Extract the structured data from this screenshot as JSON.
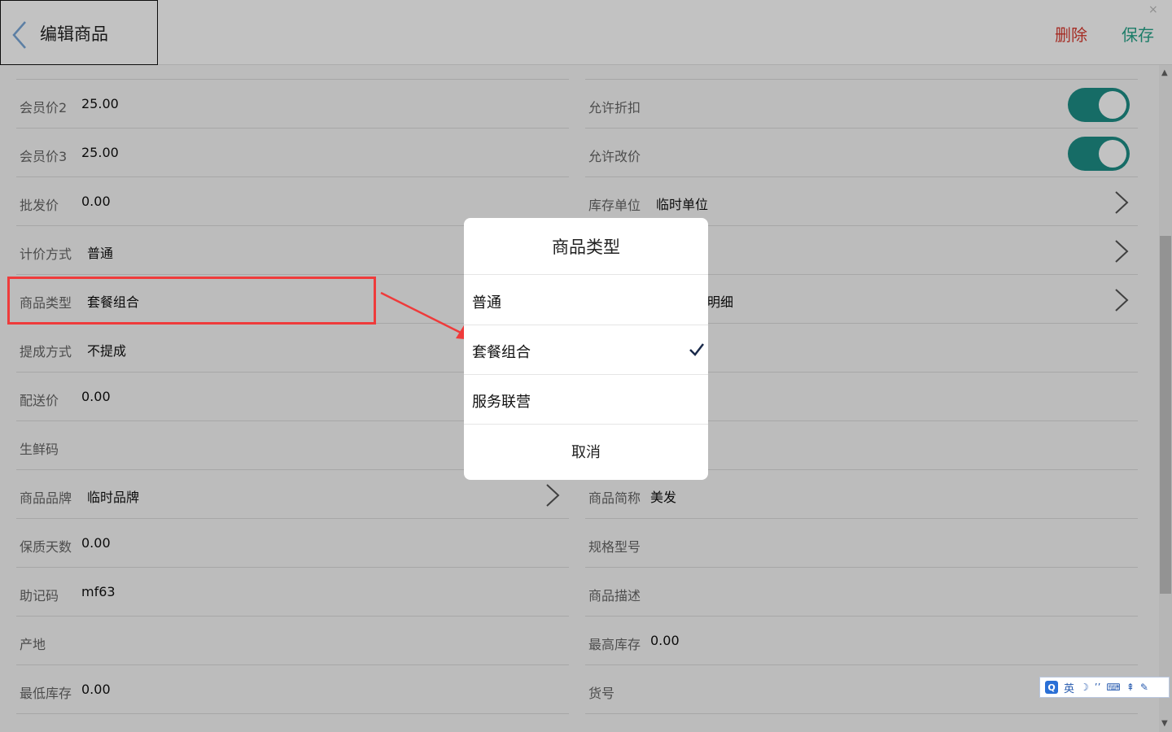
{
  "header": {
    "title": "编辑商品",
    "delete_label": "删除",
    "save_label": "保存",
    "close_glyph": "×"
  },
  "left_fields": [
    {
      "label": "会员价2",
      "value": "25.00"
    },
    {
      "label": "会员价3",
      "value": "25.00"
    },
    {
      "label": "批发价",
      "value": "0.00"
    },
    {
      "label": "计价方式",
      "value": "普通"
    },
    {
      "label": "商品类型",
      "value": "套餐组合"
    },
    {
      "label": "提成方式",
      "value": "不提成"
    },
    {
      "label": "配送价",
      "value": "0.00"
    },
    {
      "label": "生鲜码",
      "value": ""
    },
    {
      "label": "商品品牌",
      "value": "临时品牌"
    },
    {
      "label": "保质天数",
      "value": "0.00"
    },
    {
      "label": "助记码",
      "value": "mf63"
    },
    {
      "label": "产地",
      "value": ""
    },
    {
      "label": "最低库存",
      "value": "0.00"
    }
  ],
  "right_fields": [
    {
      "label": "允许折扣",
      "toggle_on": true
    },
    {
      "label": "允许改价",
      "toggle_on": true
    },
    {
      "label": "库存单位",
      "value": "临时单位"
    },
    {
      "label": "",
      "value": ""
    },
    {
      "label": "",
      "value": "明细"
    },
    {
      "label": "商品简称",
      "value": "美发"
    },
    {
      "label": "规格型号",
      "value": ""
    },
    {
      "label": "商品描述",
      "value": ""
    },
    {
      "label": "最高库存",
      "value": "0.00"
    },
    {
      "label": "货号",
      "value": ""
    }
  ],
  "dialog": {
    "title": "商品类型",
    "options": [
      {
        "label": "普通",
        "selected": false
      },
      {
        "label": "套餐组合",
        "selected": true
      },
      {
        "label": "服务联营",
        "selected": false
      }
    ],
    "cancel_label": "取消"
  },
  "ime": {
    "logo": "Q",
    "mode": "英",
    "icons": [
      "moon-icon",
      "punctuation-icon",
      "keyboard-icon",
      "tools-icon",
      "wrench-icon"
    ]
  },
  "colors": {
    "accent_toggle": "#1e8f87",
    "delete": "#d93b30",
    "save": "#27a58a",
    "highlight": "#ef3b3b",
    "checkmark": "#1a2a4a"
  }
}
